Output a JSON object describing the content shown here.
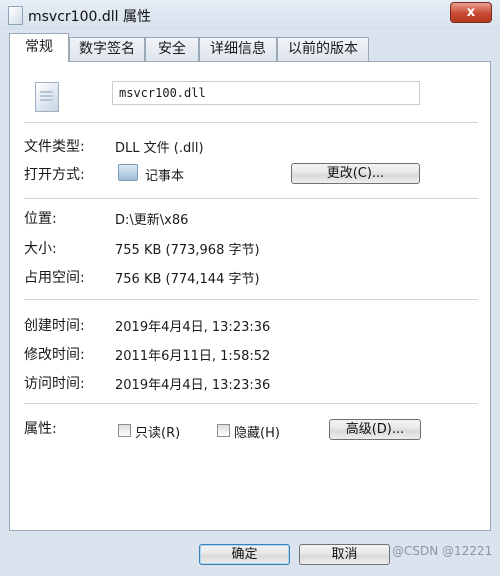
{
  "window": {
    "title": "msvcr100.dll 属性",
    "close_label": "x"
  },
  "tabs": [
    "常规",
    "数字签名",
    "安全",
    "详细信息",
    "以前的版本"
  ],
  "file": {
    "name": "msvcr100.dll"
  },
  "type": {
    "label": "文件类型:",
    "value": "DLL 文件 (.dll)"
  },
  "opens_with": {
    "label": "打开方式:",
    "app": "记事本",
    "change_button": "更改(C)..."
  },
  "location": {
    "label": "位置:",
    "value": "D:\\更新\\x86"
  },
  "size": {
    "label": "大小:",
    "value": "755 KB (773,968 字节)"
  },
  "size_on_disk": {
    "label": "占用空间:",
    "value": "756 KB (774,144 字节)"
  },
  "created": {
    "label": "创建时间:",
    "value": "2019年4月4日, 13:23:36"
  },
  "modified": {
    "label": "修改时间:",
    "value": "2011年6月11日, 1:58:52"
  },
  "accessed": {
    "label": "访问时间:",
    "value": "2019年4月4日, 13:23:36"
  },
  "attributes": {
    "label": "属性:",
    "readonly": "只读(R)",
    "hidden": "隐藏(H)",
    "advanced_button": "高级(D)..."
  },
  "footer": {
    "ok": "确定",
    "cancel": "取消",
    "watermark": "@CSDN @12221"
  }
}
